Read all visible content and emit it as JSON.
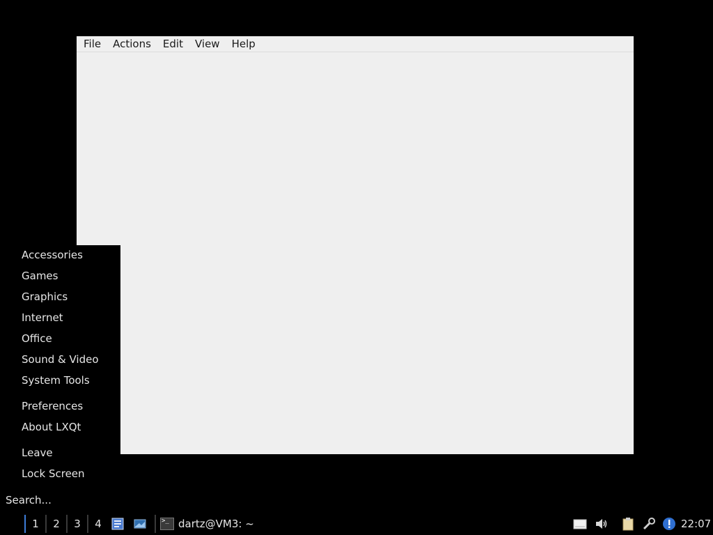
{
  "window": {
    "menubar": {
      "file": "File",
      "actions": "Actions",
      "edit": "Edit",
      "view": "View",
      "help": "Help"
    }
  },
  "start_menu": {
    "items": [
      "Accessories",
      "Games",
      "Graphics",
      "Internet",
      "Office",
      "Sound & Video",
      "System Tools",
      "Preferences",
      "About LXQt",
      "Leave",
      "Lock Screen"
    ],
    "search_placeholder": "Search..."
  },
  "taskbar": {
    "workspaces": [
      "1",
      "2",
      "3",
      "4"
    ],
    "active_workspace": "1",
    "task_label": "dartz@VM3: ~",
    "clock": "22:07",
    "tray_icons": [
      "removable-drive-icon",
      "volume-icon",
      "clipboard-icon",
      "network-tools-icon",
      "update-notifier-icon"
    ]
  },
  "colors": {
    "desktop": "#000000",
    "window_bg": "#efefef",
    "active_workspace": "#3d7dd8",
    "menu_text": "#e6e6e6"
  }
}
